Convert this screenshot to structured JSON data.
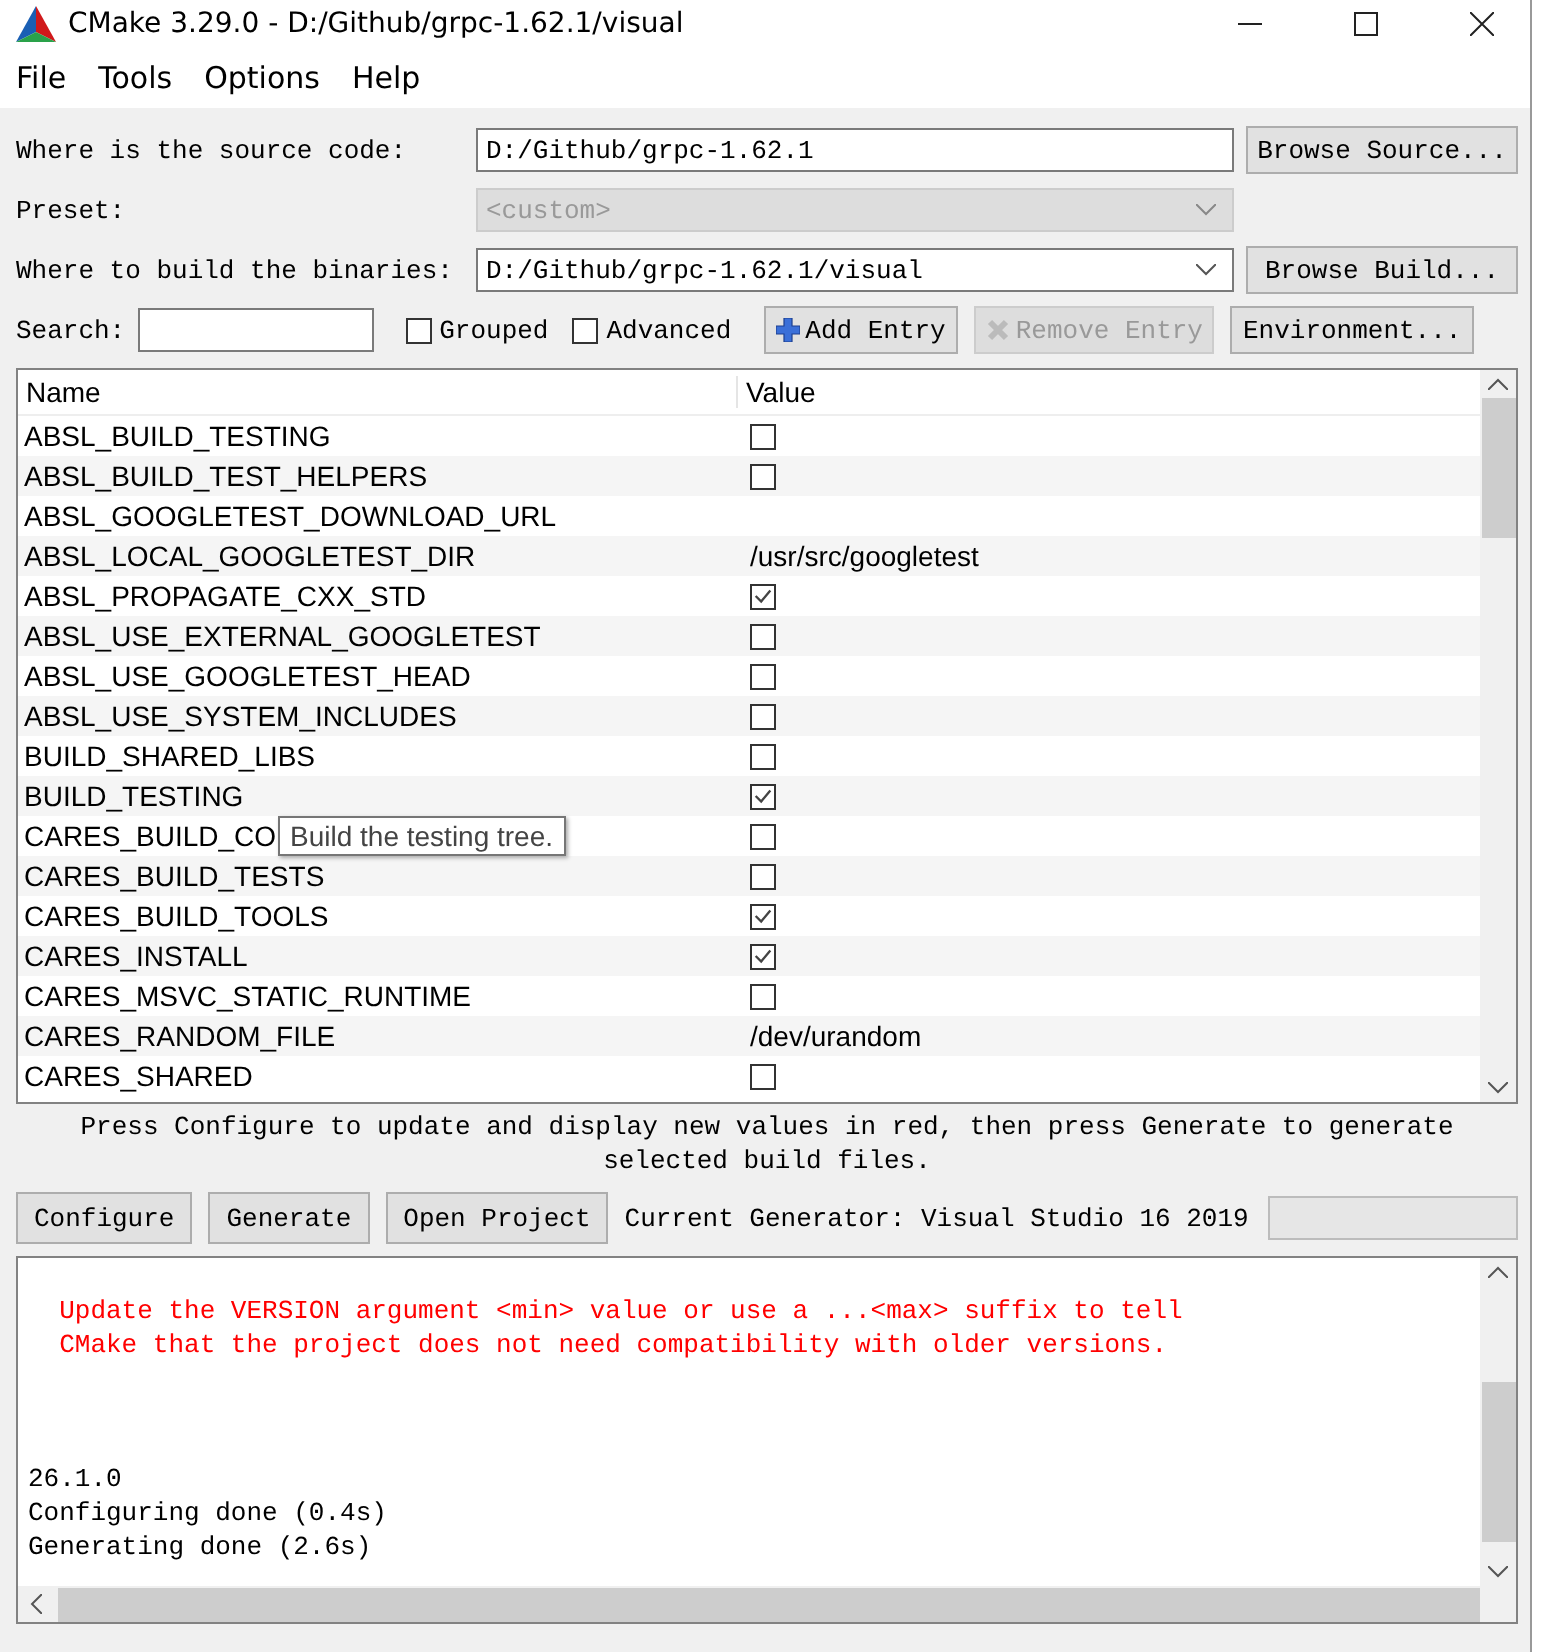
{
  "window": {
    "title": "CMake 3.29.0 - D:/Github/grpc-1.62.1/visual"
  },
  "menu": [
    "File",
    "Tools",
    "Options",
    "Help"
  ],
  "source": {
    "label": "Where is the source code:",
    "value": "D:/Github/grpc-1.62.1",
    "button": "Browse Source..."
  },
  "preset": {
    "label": "Preset:",
    "value": "<custom>",
    "disabled": true
  },
  "build": {
    "label": "Where to build the binaries:",
    "value": "D:/Github/grpc-1.62.1/visual",
    "button": "Browse Build..."
  },
  "toolbar": {
    "search_label": "Search:",
    "checkboxes": [
      {
        "label": "Grouped",
        "checked": false
      },
      {
        "label": "Advanced",
        "checked": false
      }
    ],
    "buttons": [
      {
        "label": "Add Entry",
        "kind": "add",
        "disabled": false
      },
      {
        "label": "Remove Entry",
        "kind": "remove",
        "disabled": true
      },
      {
        "label": "Environment...",
        "kind": "plain",
        "disabled": false
      }
    ]
  },
  "table": {
    "columns": [
      "Name",
      "Value"
    ],
    "rows": [
      {
        "name": "ABSL_BUILD_TESTING",
        "kind": "bool",
        "checked": false
      },
      {
        "name": "ABSL_BUILD_TEST_HELPERS",
        "kind": "bool",
        "checked": false
      },
      {
        "name": "ABSL_GOOGLETEST_DOWNLOAD_URL",
        "kind": "text"
      },
      {
        "name": "ABSL_LOCAL_GOOGLETEST_DIR",
        "kind": "text",
        "value": "/usr/src/googletest"
      },
      {
        "name": "ABSL_PROPAGATE_CXX_STD",
        "kind": "bool",
        "checked": true
      },
      {
        "name": "ABSL_USE_EXTERNAL_GOOGLETEST",
        "kind": "bool",
        "checked": false
      },
      {
        "name": "ABSL_USE_GOOGLETEST_HEAD",
        "kind": "bool",
        "checked": false
      },
      {
        "name": "ABSL_USE_SYSTEM_INCLUDES",
        "kind": "bool",
        "checked": false
      },
      {
        "name": "BUILD_SHARED_LIBS",
        "kind": "bool",
        "checked": false
      },
      {
        "name": "BUILD_TESTING",
        "kind": "bool",
        "checked": true
      },
      {
        "name": "CARES_BUILD_CO",
        "kind": "bool",
        "checked": false
      },
      {
        "name": "CARES_BUILD_TESTS",
        "kind": "bool",
        "checked": false
      },
      {
        "name": "CARES_BUILD_TOOLS",
        "kind": "bool",
        "checked": true
      },
      {
        "name": "CARES_INSTALL",
        "kind": "bool",
        "checked": true
      },
      {
        "name": "CARES_MSVC_STATIC_RUNTIME",
        "kind": "bool",
        "checked": false
      },
      {
        "name": "CARES_RANDOM_FILE",
        "kind": "text",
        "value": "/dev/urandom"
      },
      {
        "name": "CARES_SHARED",
        "kind": "bool",
        "checked": false
      }
    ],
    "tooltip": "Build the testing tree."
  },
  "hint": "Press Configure to update and display new values in red, then press Generate to generate selected build files.",
  "actions": [
    "Configure",
    "Generate",
    "Open Project"
  ],
  "generator": "Current Generator: Visual Studio 16 2019",
  "progress": {
    "level": 0
  },
  "output": [
    {
      "kind": "warning",
      "text": "  Update the VERSION argument <min> value or use a ...<max> suffix to tell"
    },
    {
      "kind": "warning",
      "text": "  CMake that the project does not need compatibility with older versions."
    },
    {
      "kind": "normal",
      "text": "26.1.0"
    },
    {
      "kind": "normal",
      "text": "Configuring done (0.4s)"
    },
    {
      "kind": "normal",
      "text": "Generating done (2.6s)"
    }
  ]
}
